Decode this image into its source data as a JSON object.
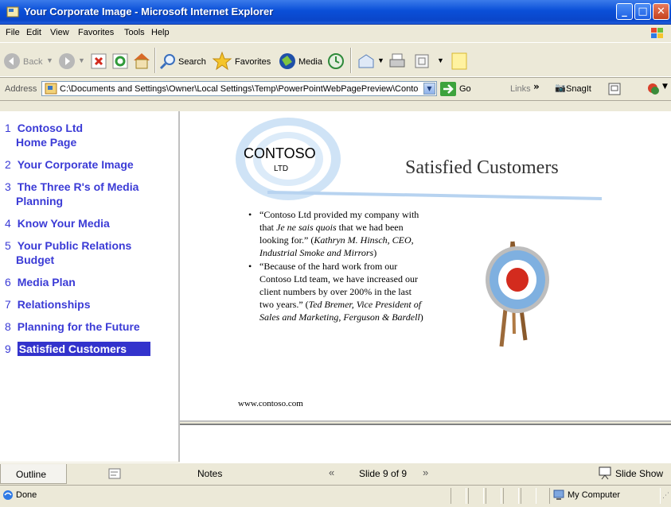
{
  "window": {
    "title": "Your Corporate Image - Microsoft Internet Explorer"
  },
  "menu": {
    "items": [
      "File",
      "Edit",
      "View",
      "Favorites",
      "Tools",
      "Help"
    ]
  },
  "toolbar": {
    "back": "Back",
    "search": "Search",
    "favorites": "Favorites",
    "media": "Media"
  },
  "address": {
    "label": "Address",
    "value": "C:\\Documents and Settings\\Owner\\Local Settings\\Temp\\PowerPointWebPagePreview\\Conto",
    "go": "Go",
    "links": "Links",
    "snagit": "SnagIt"
  },
  "outline": {
    "items": [
      {
        "num": "1",
        "line1": "Contoso Ltd",
        "line2": "Home Page"
      },
      {
        "num": "2",
        "line1": "Your Corporate Image",
        "line2": ""
      },
      {
        "num": "3",
        "line1": "The Three R's of Media",
        "line2": "Planning"
      },
      {
        "num": "4",
        "line1": "Know Your Media",
        "line2": ""
      },
      {
        "num": "5",
        "line1": "Your Public Relations",
        "line2": "Budget"
      },
      {
        "num": "6",
        "line1": "Media Plan",
        "line2": ""
      },
      {
        "num": "7",
        "line1": "Relationships",
        "line2": ""
      },
      {
        "num": "8",
        "line1": "Planning for the Future",
        "line2": ""
      },
      {
        "num": "9",
        "line1": "Satisfied Customers",
        "line2": ""
      }
    ],
    "selected_index": 8
  },
  "slide": {
    "title": "Satisfied Customers",
    "logo": "CONTOSO",
    "logo_sub": "LTD",
    "bullet1": {
      "quote_start": "“Contoso Ltd provided my company with that ",
      "italic1": "Je ne sais quois",
      "quote_mid": " that we had been looking for.” (",
      "attribution": "Kathryn M. Hinsch, CEO, Industrial Smoke and Mirrors",
      "end": ")"
    },
    "bullet2": {
      "quote": "“Because of the hard work from our Contoso Ltd team, we have increased our client numbers by over 200% in the last two years.” (",
      "attribution": "Ted Bremer, Vice President of Sales and Marketing, Ferguson & Bardell",
      "end": ")"
    },
    "footer": "www.contoso.com"
  },
  "bottombar": {
    "outline": "Outline",
    "notes": "Notes",
    "slide_counter": "Slide 9 of 9",
    "slide_show": "Slide Show"
  },
  "status": {
    "text": "Done",
    "zone": "My Computer"
  },
  "colors": {
    "accent": "#3b3bd6",
    "selected_bg": "#3333cc",
    "titlebar": "#0a4fd8",
    "target_red": "#d32b1e",
    "target_blue": "#7fb0e0"
  }
}
